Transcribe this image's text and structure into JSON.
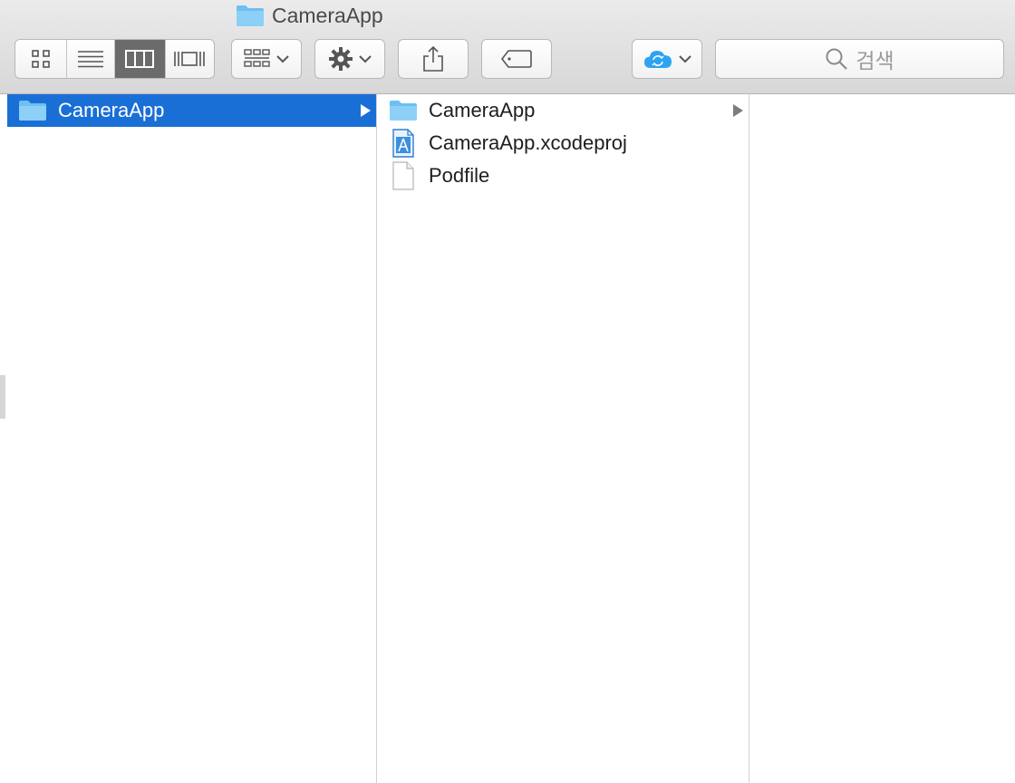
{
  "window": {
    "title": "CameraApp"
  },
  "toolbar": {
    "view_modes": [
      {
        "name": "icon-view",
        "icon": "grid-icon",
        "active": false
      },
      {
        "name": "list-view",
        "icon": "list-icon",
        "active": false
      },
      {
        "name": "column-view",
        "icon": "columns-icon",
        "active": true
      },
      {
        "name": "cover-flow-view",
        "icon": "coverflow-icon",
        "active": false
      }
    ],
    "arrange_icon": "arrange-grid-icon",
    "action_icon": "gear-icon",
    "share_icon": "share-icon",
    "tags_icon": "tag-icon",
    "icloud_icon": "icloud-icon",
    "search": {
      "placeholder": "검색",
      "icon": "search-icon"
    }
  },
  "columns": [
    {
      "items": [
        {
          "label": "CameraApp",
          "icon": "folder-icon",
          "selected": true,
          "has_children": true
        }
      ]
    },
    {
      "items": [
        {
          "label": "CameraApp",
          "icon": "folder-icon",
          "selected": false,
          "has_children": true
        },
        {
          "label": "CameraApp.xcodeproj",
          "icon": "xcodeproj-icon",
          "selected": false,
          "has_children": false
        },
        {
          "label": "Podfile",
          "icon": "document-icon",
          "selected": false,
          "has_children": false
        }
      ]
    },
    {
      "items": []
    }
  ],
  "colors": {
    "selection": "#1a6fd6",
    "folder": "#6cc0f2",
    "icloud": "#2ea3f2"
  }
}
